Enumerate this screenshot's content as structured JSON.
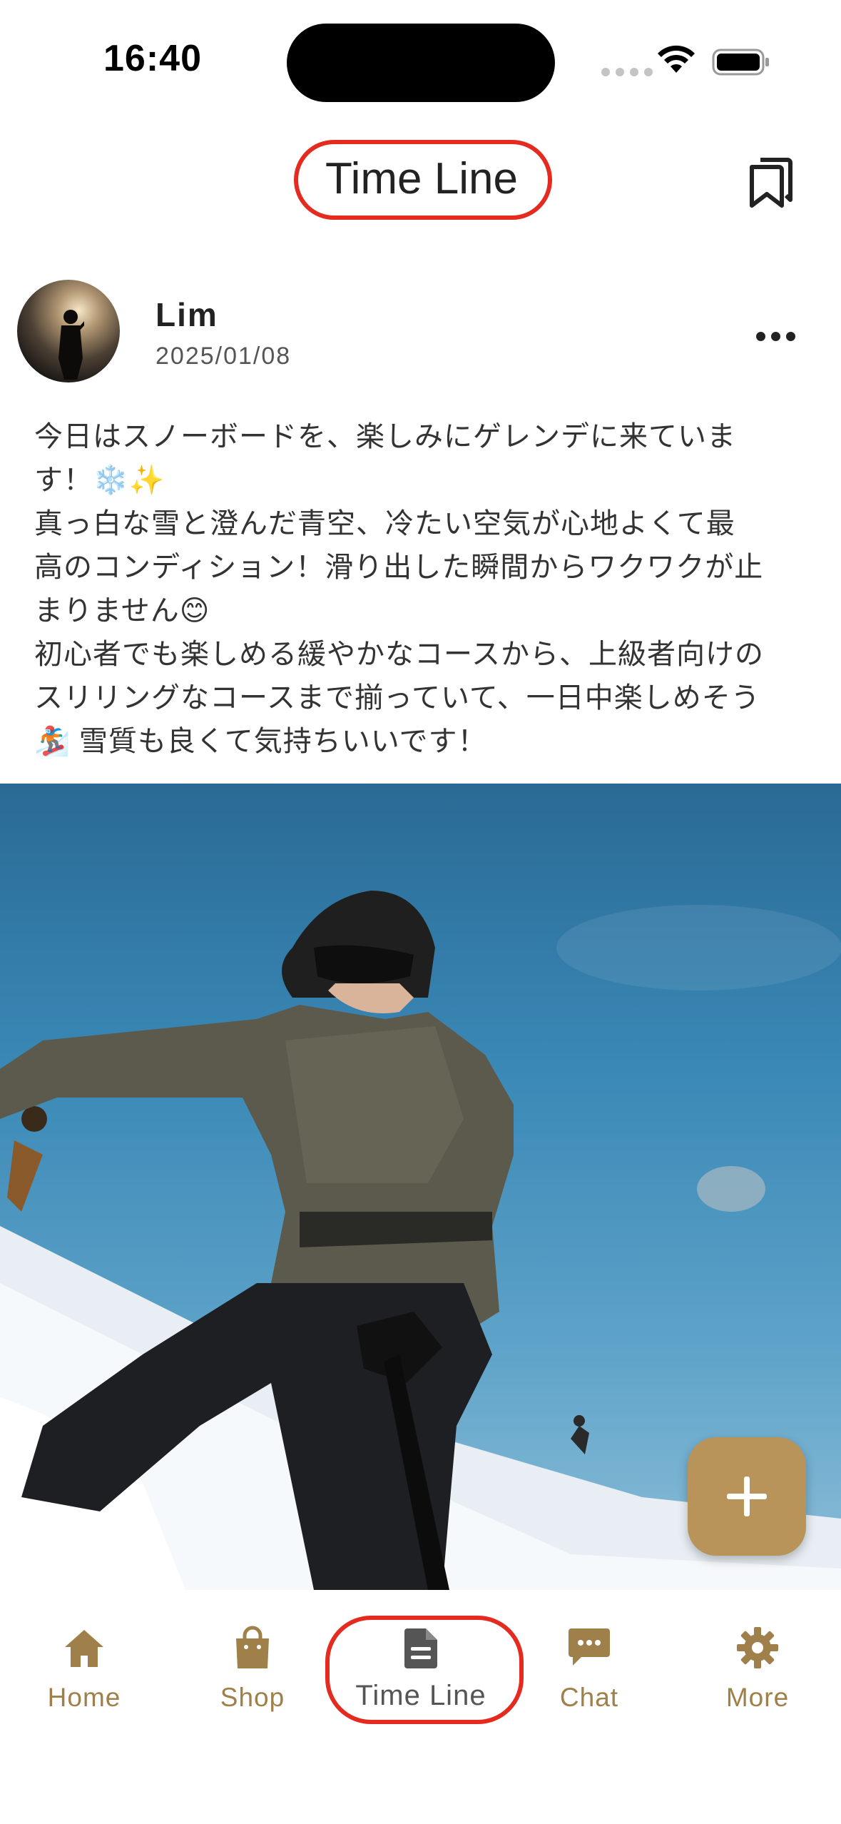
{
  "status_bar": {
    "time": "16:40"
  },
  "header": {
    "title": "Time Line",
    "bookmark_icon": "bookmark-icon"
  },
  "post": {
    "author": "Lim",
    "date": "2025/01/08",
    "more_icon": "more-horizontal-icon",
    "body_lines": [
      "今日はスノーボードを、楽しみにゲレンデに来ていま",
      "す！❄️✨",
      "真っ白な雪と澄んだ青空、冷たい空気が心地よくて最",
      "高のコンディション！滑り出した瞬間からワクワクが止",
      "まりません😊",
      "初心者でも楽しめる緩やかなコースから、上級者向けの",
      "スリリングなコースまで揃っていて、一日中楽しめそう",
      "🏂 雪質も良くて気持ちいいです！"
    ]
  },
  "fab": {
    "icon": "plus-icon"
  },
  "bottom_nav": {
    "items": [
      {
        "label": "Home",
        "icon": "home-icon"
      },
      {
        "label": "Shop",
        "icon": "shopping-bag-icon"
      },
      {
        "label": "Time Line",
        "icon": "document-icon",
        "active": true
      },
      {
        "label": "Chat",
        "icon": "chat-bubble-icon"
      },
      {
        "label": "More",
        "icon": "gear-icon"
      }
    ]
  },
  "colors": {
    "accent": "#b8935a",
    "nav_inactive": "#a0804a",
    "nav_active": "#555555",
    "highlight_ring": "#e52a1f"
  }
}
